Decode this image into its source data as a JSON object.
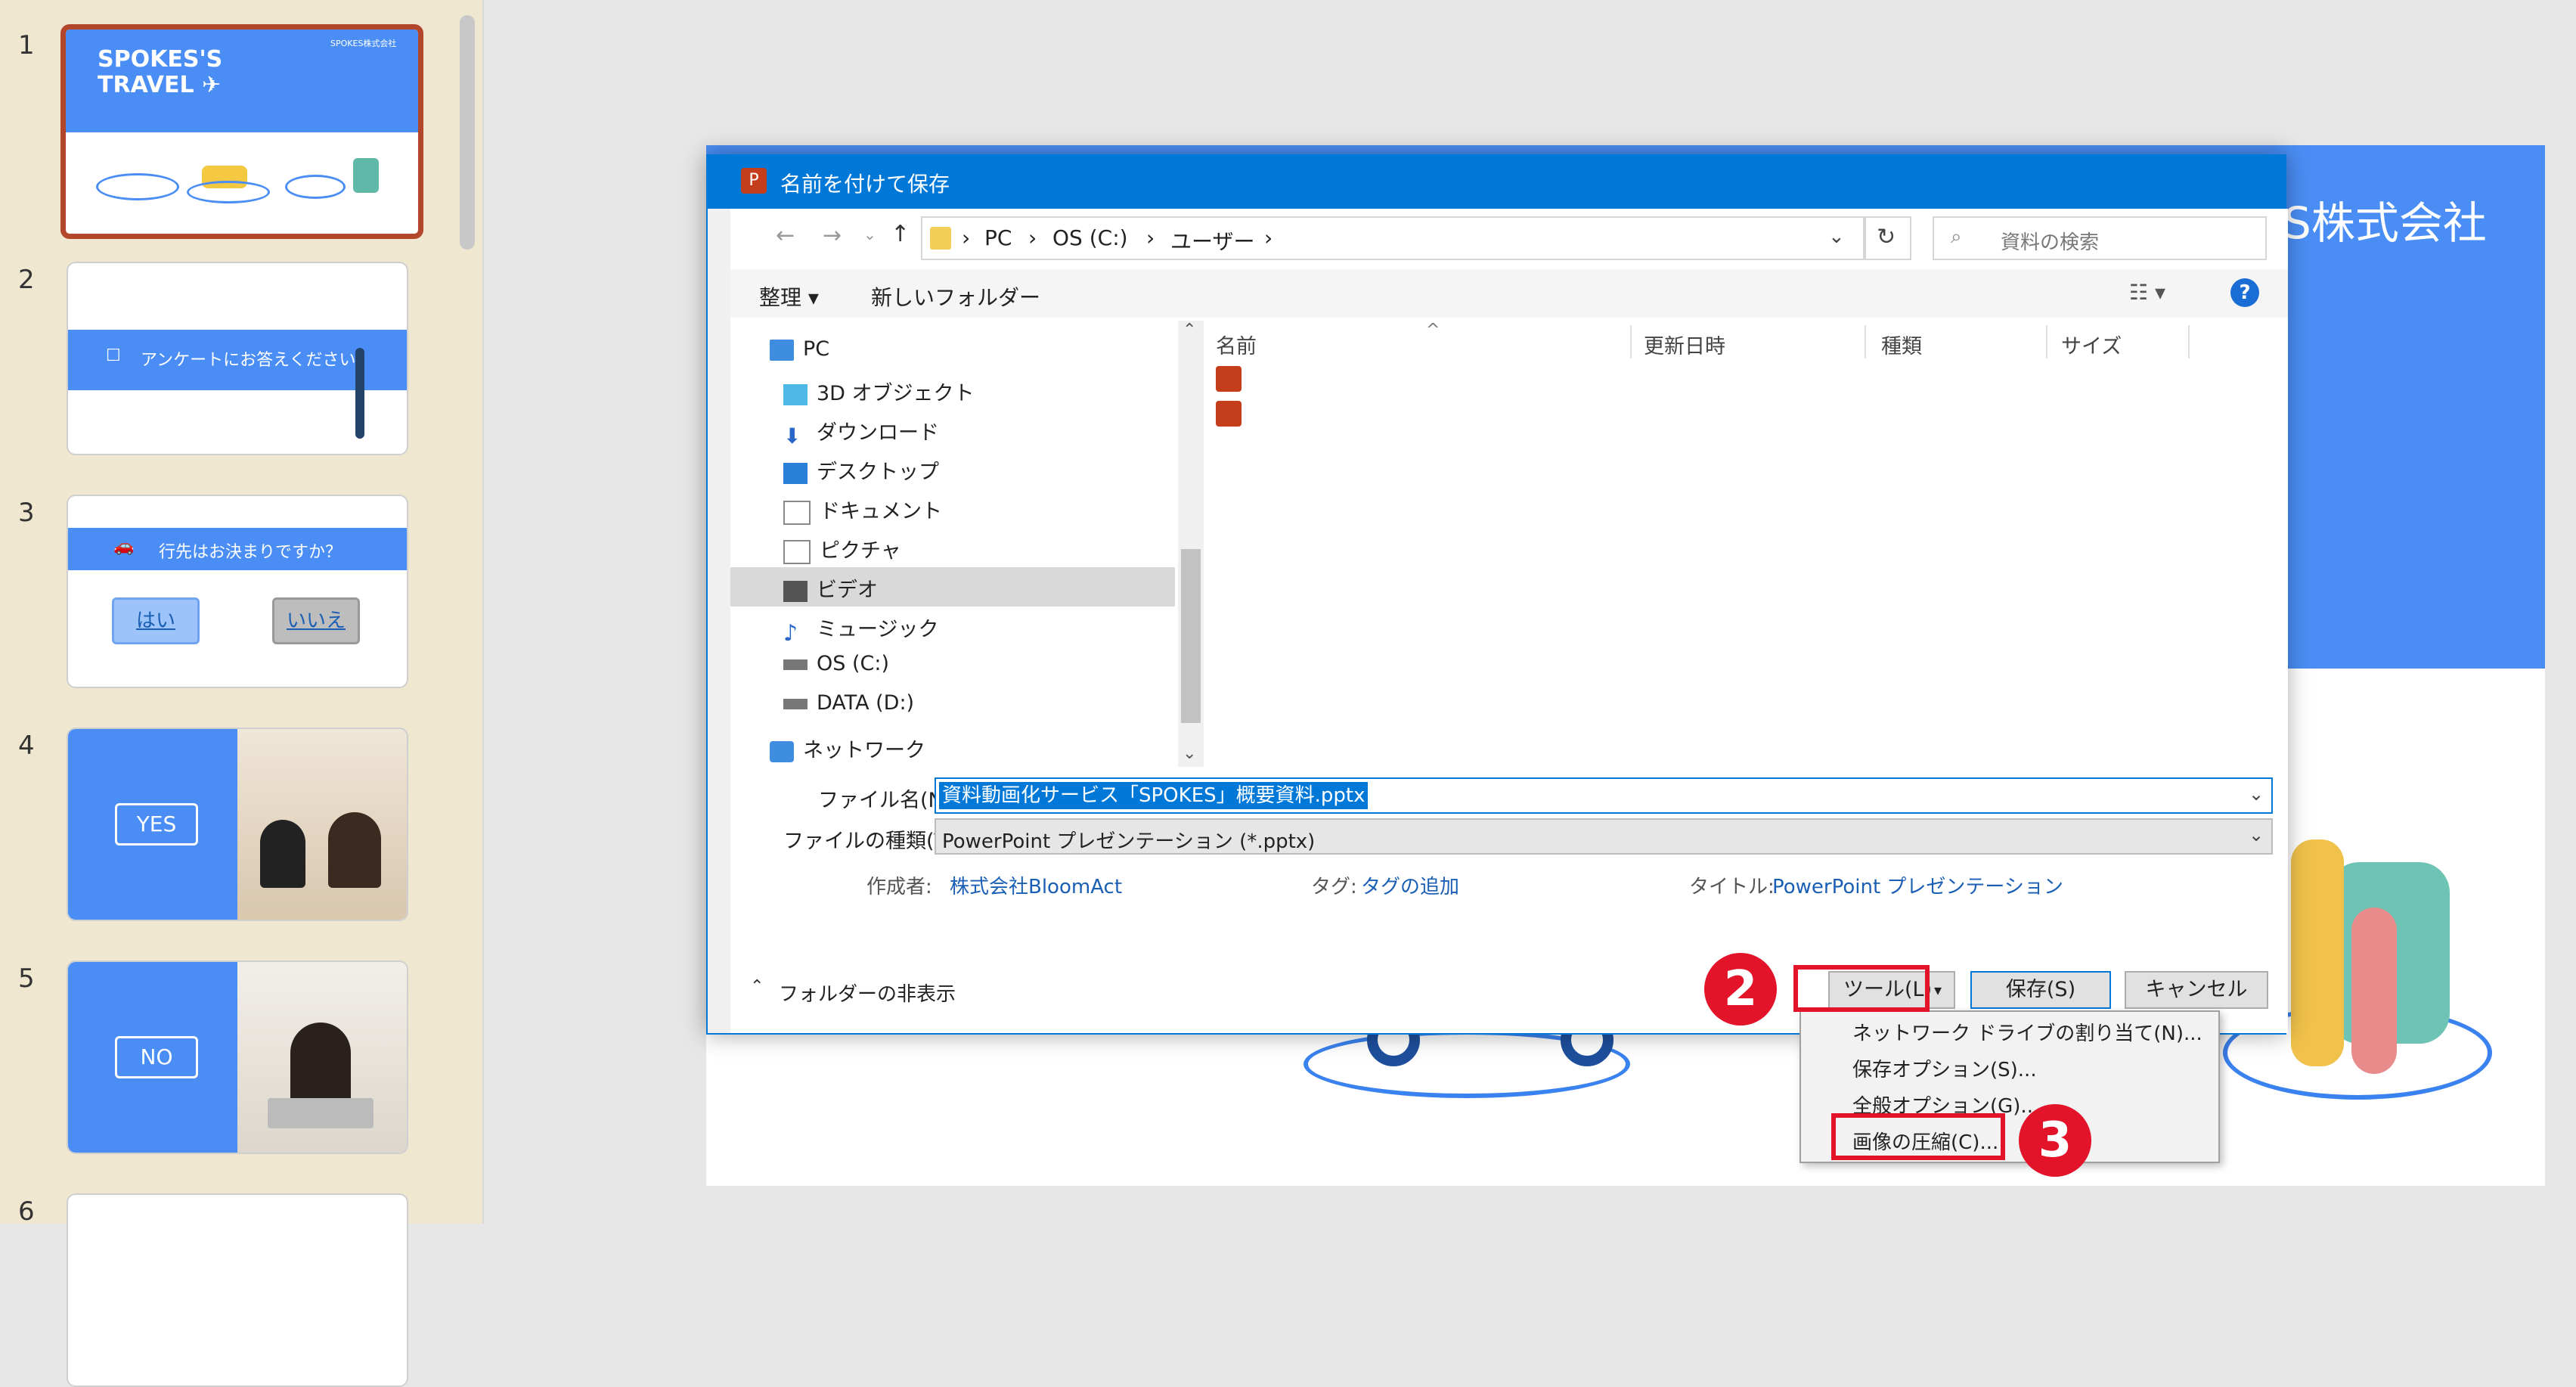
{
  "thumbnails": {
    "slides": [
      {
        "num": "1",
        "brand": "SPOKES'S",
        "brand2": "TRAVEL ✈",
        "corner": "SPOKES株式会社"
      },
      {
        "num": "2",
        "banner": "アンケートにお答えください"
      },
      {
        "num": "3",
        "banner": "行先はお決まりですか？",
        "yes": "はい",
        "no": "いいえ"
      },
      {
        "num": "4",
        "label": "YES"
      },
      {
        "num": "5",
        "label": "NO"
      },
      {
        "num": "6"
      }
    ]
  },
  "slide": {
    "title": "S株式会社",
    "banner_color": "#4a8ef5"
  },
  "dialog": {
    "title": "名前を付けて保存",
    "breadcrumb": [
      "PC",
      "OS (C:)",
      "ユーザー"
    ],
    "search_placeholder": "資料の検索",
    "toolbar": {
      "organize": "整理 ▾",
      "new_folder": "新しいフォルダー",
      "help": "?"
    },
    "tree": [
      "PC",
      "3D オブジェクト",
      "ダウンロード",
      "デスクトップ",
      "ドキュメント",
      "ピクチャ",
      "ビデオ",
      "ミュージック",
      "OS (C:)",
      "DATA (D:)",
      "ネットワーク"
    ],
    "columns": {
      "name": "名前",
      "date": "更新日時",
      "type": "種類",
      "size": "サイズ"
    },
    "file_name_label": "ファイル名(N):",
    "file_name_value": "資料動画化サービス「SPOKES」概要資料.pptx",
    "file_type_label": "ファイルの種類(T):",
    "file_type_value": "PowerPoint プレゼンテーション (*.pptx)",
    "author_label": "作成者:",
    "author_value": "株式会社BloomAct",
    "tag_label": "タグ:",
    "tag_value": "タグの追加",
    "doc_title_label": "タイトル:",
    "doc_title_value": "PowerPoint プレゼンテーション",
    "hide_folders": "フォルダーの非表示",
    "tools_button": "ツール(L)",
    "save_button": "保存(S)",
    "cancel_button": "キャンセル",
    "tools_menu": [
      "ネットワーク ドライブの割り当て(N)...",
      "保存オプション(S)...",
      "全般オプション(G)...",
      "画像の圧縮(C)..."
    ]
  },
  "callouts": {
    "step2": "2",
    "step3": "3",
    "color": "#e3142a"
  }
}
